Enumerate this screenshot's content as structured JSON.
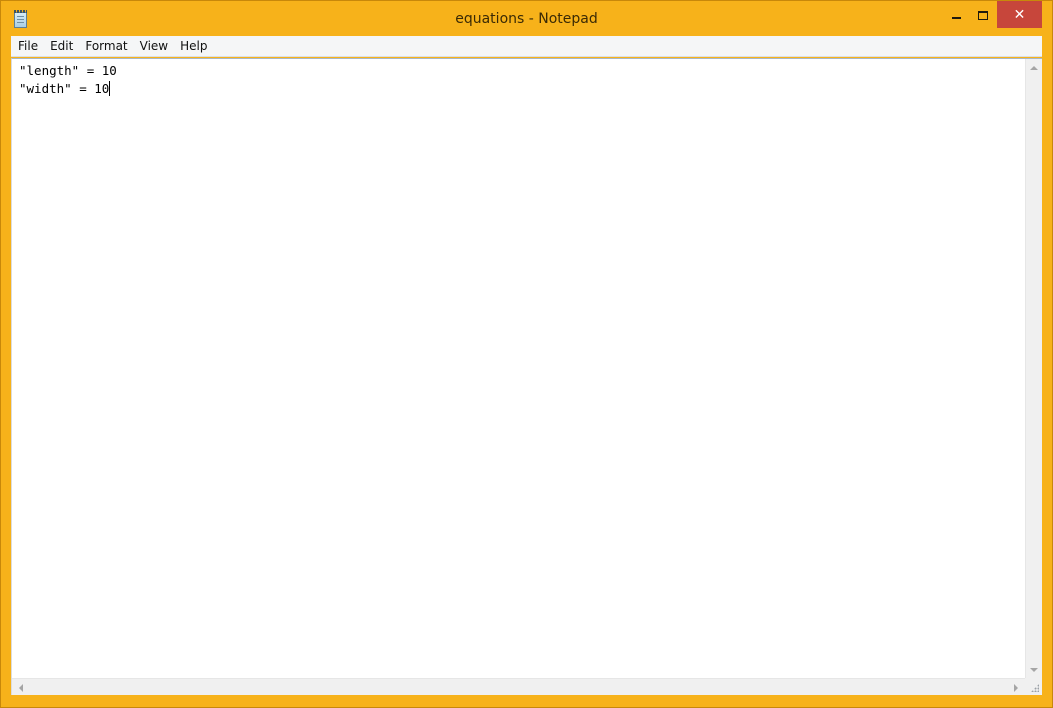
{
  "window": {
    "title": "equations - Notepad",
    "app_icon": "notepad-icon",
    "frame_color": "#f7b21a",
    "close_color": "#c7463b"
  },
  "controls": {
    "minimize_icon": "minimize-icon",
    "maximize_icon": "maximize-icon",
    "close_icon": "close-icon",
    "close_glyph": "✕"
  },
  "menu": {
    "items": [
      {
        "label": "File"
      },
      {
        "label": "Edit"
      },
      {
        "label": "Format"
      },
      {
        "label": "View"
      },
      {
        "label": "Help"
      }
    ]
  },
  "document": {
    "lines": [
      "\"length\" = 10",
      "\"width\" = 10"
    ]
  },
  "scrollbars": {
    "vertical_icons": [
      "scroll-up-icon",
      "scroll-down-icon"
    ],
    "horizontal_icons": [
      "scroll-left-icon",
      "scroll-right-icon"
    ]
  }
}
